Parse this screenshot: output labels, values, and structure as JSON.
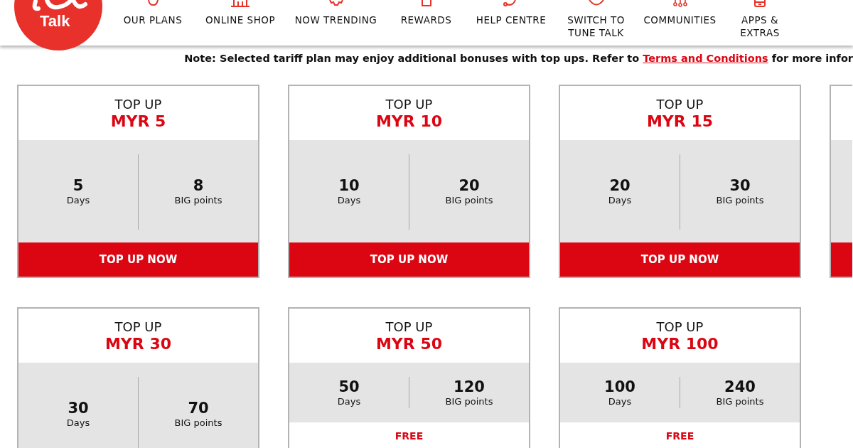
{
  "header": {
    "logo": {
      "text": "Talk"
    },
    "nav": [
      {
        "label": "OUR PLANS"
      },
      {
        "label": "ONLINE SHOP"
      },
      {
        "label": "NOW TRENDING"
      },
      {
        "label": "REWARDS"
      },
      {
        "label": "HELP CENTRE"
      },
      {
        "label": "SWITCH TO\nTUNE TALK"
      },
      {
        "label": "COMMUNITIES"
      },
      {
        "label": "APPS &\nEXTRAS"
      }
    ]
  },
  "note": {
    "text": "Note: Selected tariff plan may enjoy additional bonuses with top ups. Refer to ",
    "link": "Terms and Conditions",
    "text_after": " for more infor"
  },
  "cards": [
    {
      "kind": "plain",
      "heading": "TOP UP",
      "price": "MYR 5",
      "days": "5",
      "days_label": "Days",
      "points": "8",
      "points_label": "BIG points",
      "button": "TOP UP NOW"
    },
    {
      "kind": "plain",
      "heading": "TOP UP",
      "price": "MYR 10",
      "days": "10",
      "days_label": "Days",
      "points": "20",
      "points_label": "BIG points",
      "button": "TOP UP NOW"
    },
    {
      "kind": "plain",
      "heading": "TOP UP",
      "price": "MYR 15",
      "days": "20",
      "days_label": "Days",
      "points": "30",
      "points_label": "BIG points",
      "button": "TOP UP NOW"
    },
    {
      "kind": "clipped"
    },
    {
      "kind": "plain",
      "heading": "TOP UP",
      "price": "MYR 30",
      "days": "30",
      "days_label": "Days",
      "points": "70",
      "points_label": "BIG points"
    },
    {
      "kind": "bonus",
      "heading": "TOP UP",
      "price": "MYR 50",
      "days": "50",
      "days_label": "Days",
      "points": "120",
      "points_label": "BIG points",
      "bonus": "FREE"
    },
    {
      "kind": "bonus",
      "heading": "TOP UP",
      "price": "MYR 100",
      "days": "100",
      "days_label": "Days",
      "points": "240",
      "points_label": "BIG points",
      "bonus": "FREE"
    }
  ]
}
